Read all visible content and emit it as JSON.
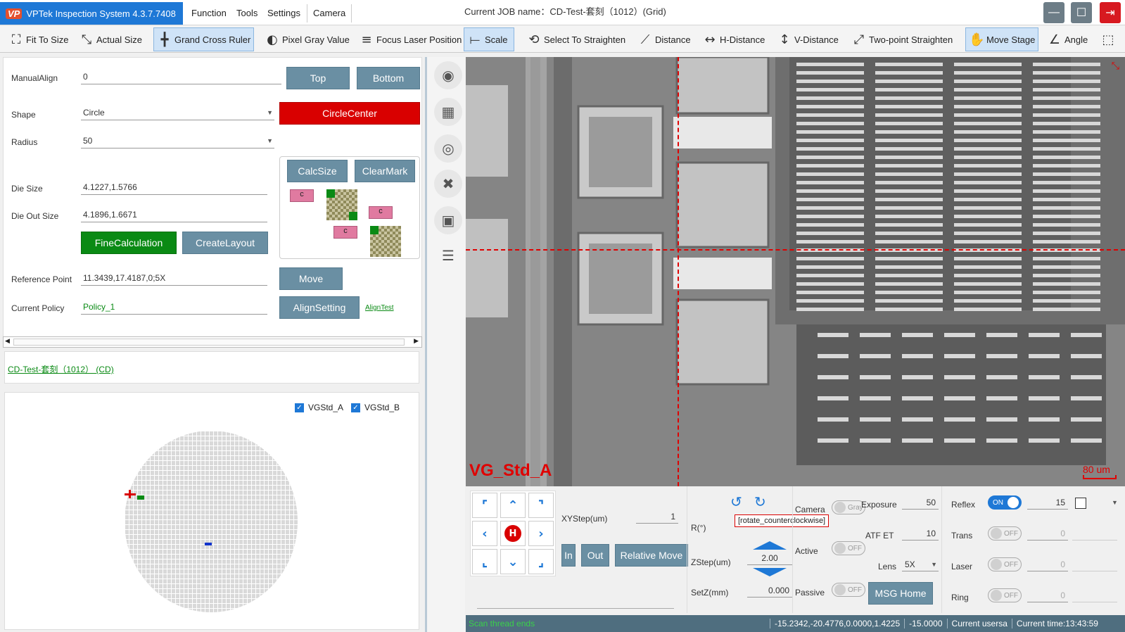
{
  "app": {
    "logo": "VP",
    "title": "VPTek Inspection System 4.3.7.7408"
  },
  "menu": [
    "Function",
    "Tools",
    "Settings",
    "Camera"
  ],
  "job_title": "Current JOB name：CD-Test-套刻（1012）(Grid)",
  "toolbar": [
    {
      "label": "Fit To Size",
      "icon": "fit-icon",
      "glyph": "⛶"
    },
    {
      "label": "Actual Size",
      "icon": "expand-icon",
      "glyph": "⤡"
    },
    {
      "label": "Grand Cross Ruler",
      "icon": "cross-ruler-icon",
      "glyph": "╋"
    },
    {
      "label": "Pixel Gray Value",
      "icon": "contrast-icon",
      "glyph": "◐"
    },
    {
      "label": "Focus Laser Position",
      "icon": "laser-icon",
      "glyph": "≡"
    },
    {
      "label": "Scale",
      "icon": "scale-icon",
      "glyph": "⟝"
    },
    {
      "label": "Select To Straighten",
      "icon": "straighten-icon",
      "glyph": "⟲"
    },
    {
      "label": "Distance",
      "icon": "ruler-icon",
      "glyph": "⟋"
    },
    {
      "label": "H-Distance",
      "icon": "h-distance-icon",
      "glyph": "↔"
    },
    {
      "label": "V-Distance",
      "icon": "v-distance-icon",
      "glyph": "↕"
    },
    {
      "label": "Two-point Straighten",
      "icon": "two-point-icon",
      "glyph": "⤢"
    },
    {
      "label": "Move Stage",
      "icon": "hand-icon",
      "glyph": "✋"
    },
    {
      "label": "Angle",
      "icon": "angle-icon",
      "glyph": "∠"
    },
    {
      "label": "",
      "icon": "more-icon",
      "glyph": "⬚"
    }
  ],
  "align": {
    "manual_align_label": "ManualAlign",
    "manual_align_value": "0",
    "top_btn": "Top",
    "bottom_btn": "Bottom",
    "shape_label": "Shape",
    "shape_value": "Circle",
    "circle_center_btn": "CircleCenter",
    "radius_label": "Radius",
    "radius_value": "50",
    "calcsize_btn": "CalcSize",
    "clearmark_btn": "ClearMark",
    "die_size_label": "Die Size",
    "die_size_value": "4.1227,1.5766",
    "die_out_size_label": "Die Out Size",
    "die_out_size_value": "4.1896,1.6671",
    "fine_calc_btn": "FineCalculation",
    "create_layout_btn": "CreateLayout",
    "ref_point_label": "Reference Point",
    "ref_point_value": "11.3439,17.4187,0;5X",
    "move_btn": "Move",
    "policy_label": "Current Policy",
    "policy_value": "Policy_1",
    "align_setting_btn": "AlignSetting",
    "align_test_link": "AlignTest",
    "diagram_label": "c"
  },
  "job_link": "CD-Test-套刻（1012） (CD)",
  "wafer": {
    "check_a": "VGStd_A",
    "check_b": "VGStd_B"
  },
  "camera": {
    "label": "VG_Std_A",
    "scale": "80 um"
  },
  "control": {
    "xystep_label": "XYStep(um)",
    "xystep_value": "1",
    "r_label": "R(°)",
    "rotate_tooltip": "[rotate_counterclockwise]",
    "in_btn": "In",
    "out_btn": "Out",
    "relative_move_btn": "Relative Move",
    "zstep_label": "ZStep(um)",
    "zstep_value": "2.00",
    "setz_label": "SetZ(mm)",
    "setz_value": "0.000",
    "home_glyph": "H",
    "camera_label": "Camera",
    "gray_label": "Gray",
    "active_label": "Active",
    "passive_label": "Passive",
    "msg_home_btn": "MSG Home",
    "exposure_label": "Exposure",
    "exposure_value": "50",
    "atf_label": "ATF ET",
    "atf_value": "10",
    "lens_label": "Lens",
    "lens_value": "5X",
    "reflex_label": "Reflex",
    "reflex_value": "15",
    "trans_label": "Trans",
    "trans_value": "0",
    "laser_label": "Laser",
    "laser_value": "0",
    "ring_label": "Ring",
    "ring_value": "0",
    "on": "ON",
    "off": "OFF"
  },
  "status": {
    "message": "Scan thread ends",
    "coords": "-15.2342,-20.4776,0.0000,1.4225",
    "z": "-15.0000",
    "user": "Current usersa",
    "time": "Current time:13:43:59"
  },
  "colors": {
    "accent": "#1e78d6",
    "danger": "#d90000",
    "success": "#0a8a14",
    "button": "#6a8fa3"
  }
}
